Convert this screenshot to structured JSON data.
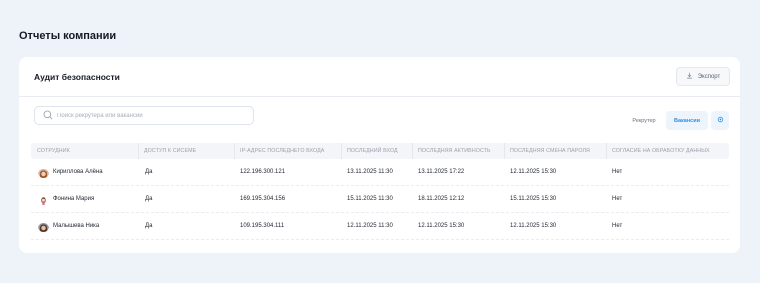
{
  "page_title": "Отчеты компании",
  "card": {
    "title": "Аудит безопасности",
    "export_label": "Экспорт"
  },
  "search": {
    "placeholder": "Поиск рекрутера или вакансии"
  },
  "filters": {
    "recruiter": "Рекрутер",
    "vacancy": "Вакансии"
  },
  "table": {
    "columns": [
      "СОТРУДНИК",
      "ДОСТУП К СИСЕМЕ",
      "IP-АДРЕС ПОСЛЕДНЕГО ВХОДА",
      "ПОСЛЕДНИЙ ВХОД",
      "ПОСЛЕДНЯЯ АКТИВНОСТЬ",
      "ПОСЛЕДНЯЯ СМЕНА ПАРОЛЯ",
      "СОГЛАСИЕ НА ОБРАБОТКУ ДАННЫХ"
    ],
    "rows": [
      {
        "name": "Кириллова Алёна",
        "access": "Да",
        "ip": "122.196.300.121",
        "last_login": "13.11.2025 11:30",
        "last_activity": "13.11.2025 17:22",
        "password_change": "12.11.2025 15:30",
        "consent": "Нет"
      },
      {
        "name": "Фонина Мария",
        "access": "Да",
        "ip": "169.195.304.156",
        "last_login": "15.11.2025 11:30",
        "last_activity": "18.11.2025 12:12",
        "password_change": "15.11.2025 15:30",
        "consent": "Нет"
      },
      {
        "name": "Малышева Ника",
        "access": "Да",
        "ip": "109.195.304.111",
        "last_login": "12.11.2025 11:30",
        "last_activity": "12.11.2025 15:30",
        "password_change": "12.11.2025 15:30",
        "consent": "Нет"
      }
    ]
  },
  "icons": {
    "export": "download-icon",
    "search": "search-icon",
    "settings": "settings-icon"
  },
  "colors": {
    "accent": "#2f8fe0",
    "background": "#eef3f9"
  }
}
